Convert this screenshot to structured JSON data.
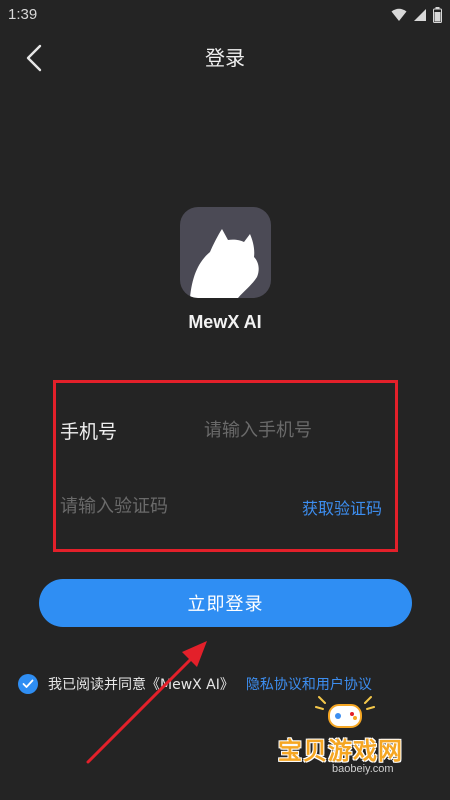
{
  "status_bar": {
    "time": "1:39"
  },
  "header": {
    "title": "登录",
    "back_icon": "chevron-left-icon"
  },
  "app": {
    "name": "MewX AI",
    "logo_icon": "cat-silhouette-icon",
    "logo_bg": "#4b4a55"
  },
  "form": {
    "phone_label": "手机号",
    "phone_placeholder": "请输入手机号",
    "phone_value": "",
    "code_placeholder": "请输入验证码",
    "code_value": "",
    "get_code_label": "获取验证码"
  },
  "login_button": {
    "label": "立即登录",
    "color": "#2f8ef3"
  },
  "agreement": {
    "checked": true,
    "text": "我已阅读并同意《MewX AI》",
    "link": "隐私协议和用户协议"
  },
  "watermark": {
    "title": "宝贝游戏网",
    "url": "baobeiy.com"
  },
  "colors": {
    "background": "#242424",
    "accent": "#2f8ef3",
    "link": "#3d8ef0",
    "annotation": "#e3202a"
  }
}
